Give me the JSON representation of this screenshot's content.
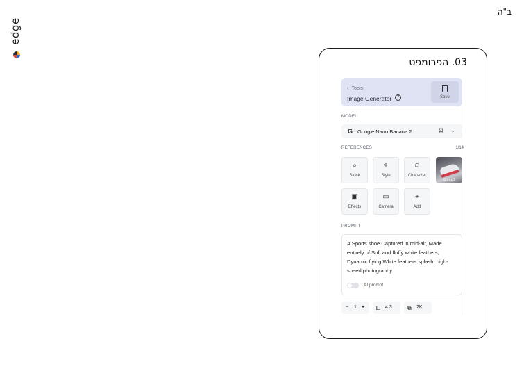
{
  "corner_mark": "ב\"ה",
  "brand": {
    "wordmark": "edge"
  },
  "card": {
    "title": "03. הפרומפט"
  },
  "panel": {
    "back_label": "Tools",
    "tool_name": "Image Generator",
    "save_label": "Save",
    "model_label": "MODEL",
    "model_name": "Google Nano Banana 2",
    "references_label": "REFERENCES",
    "references_count": "1/14",
    "tiles": [
      "Stock",
      "Style",
      "Character",
      "Effects",
      "Camera",
      "Add"
    ],
    "ref_image_tag": "@img1",
    "prompt_label": "PROMPT",
    "prompt_text": "A Sports shoe Captured in mid-air, Made entirely of Soft and fluffy white feathers, Dynamic flying White feathers splash, high-speed photography",
    "ai_prompt_label": "AI prompt",
    "quantity": "1",
    "aspect_ratio": "4:3",
    "resolution": "2K"
  },
  "icons": {
    "stock": "search-icon",
    "style": "sparkle-icon",
    "character": "person-icon",
    "effects": "image-icon",
    "camera": "folder-icon",
    "add": "plus-icon"
  }
}
